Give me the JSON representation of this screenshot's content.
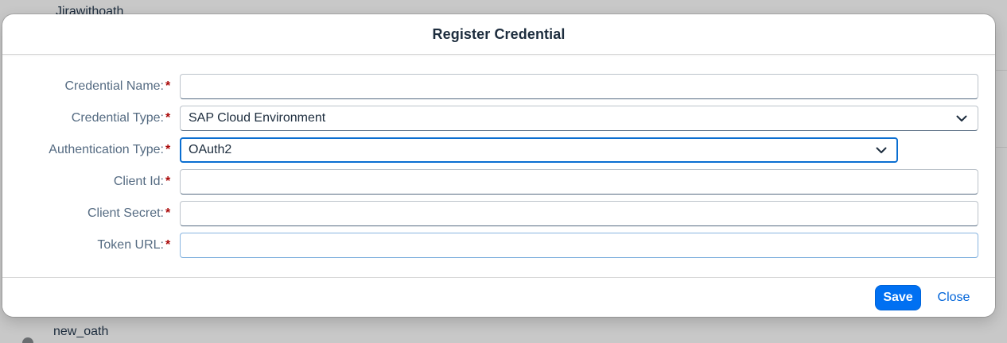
{
  "background": {
    "top_item_label": "Jirawithoath",
    "bottom_item_label": "new_oath"
  },
  "dialog": {
    "title": "Register Credential",
    "required_marker": "*",
    "fields": {
      "credential_name": {
        "label": "Credential Name:",
        "value": "",
        "placeholder": ""
      },
      "credential_type": {
        "label": "Credential Type:",
        "selected": "SAP Cloud Environment"
      },
      "authentication_type": {
        "label": "Authentication Type:",
        "selected": "OAuth2"
      },
      "client_id": {
        "label": "Client Id:",
        "value": "",
        "placeholder": ""
      },
      "client_secret": {
        "label": "Client Secret:",
        "value": "",
        "placeholder": ""
      },
      "token_url": {
        "label": "Token URL:",
        "value": "",
        "placeholder": ""
      }
    },
    "footer": {
      "save_label": "Save",
      "close_label": "Close"
    }
  },
  "colors": {
    "accent": "#0070f2",
    "required": "#aa0808",
    "label": "#556b82",
    "text": "#1d2d3e"
  },
  "icons": {
    "dropdown": "chevron-down-icon"
  }
}
